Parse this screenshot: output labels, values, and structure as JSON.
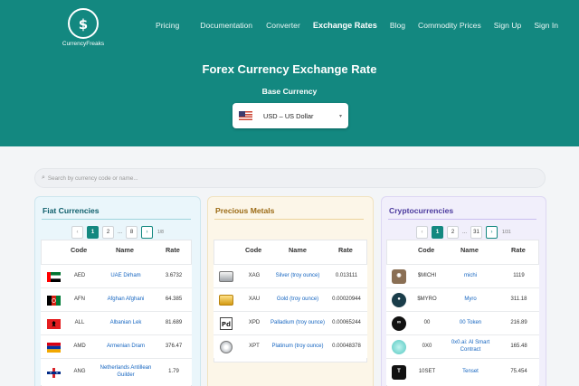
{
  "brand": {
    "name": "CurrencyFreaks",
    "logo_glyph": "$"
  },
  "nav": [
    {
      "label": "Pricing",
      "active": false
    },
    {
      "label": "Documentation",
      "active": false
    },
    {
      "label": "Converter",
      "active": false
    },
    {
      "label": "Exchange Rates",
      "active": true
    },
    {
      "label": "Blog",
      "active": false
    },
    {
      "label": "Commodity Prices",
      "active": false
    },
    {
      "label": "Sign Up",
      "active": false
    },
    {
      "label": "Sign In",
      "active": false
    }
  ],
  "hero": {
    "title": "Forex Currency Exchange Rate",
    "base_label": "Base Currency",
    "base_value": "USD – US Dollar",
    "base_flag_icon": "us-flag-icon"
  },
  "search": {
    "placeholder": "Search by currency code or name..."
  },
  "columns": {
    "code": "Code",
    "name": "Name",
    "rate": "Rate"
  },
  "fiat": {
    "title": "Fiat Currencies",
    "pager": {
      "prev": "‹",
      "p1": "1",
      "p2": "2",
      "dots": "...",
      "last": "8",
      "next": "›",
      "count": "1/8"
    },
    "rows": [
      {
        "code": "AED",
        "name": "UAE Dirham",
        "rate": "3.6732",
        "icon": "uae-flag-icon"
      },
      {
        "code": "AFN",
        "name": "Afghan Afghani",
        "rate": "64.385",
        "icon": "afghanistan-flag-icon"
      },
      {
        "code": "ALL",
        "name": "Albanian Lek",
        "rate": "81.689",
        "icon": "albania-flag-icon"
      },
      {
        "code": "AMD",
        "name": "Armenian Dram",
        "rate": "376.47",
        "icon": "armenia-flag-icon"
      },
      {
        "code": "ANG",
        "name": "Netherlands Antillean Guilder",
        "rate": "1.79",
        "icon": "netherlands-antilles-flag-icon"
      }
    ]
  },
  "metals": {
    "title": "Precious Metals",
    "rows": [
      {
        "code": "XAG",
        "name": "Silver (troy ounce)",
        "rate": "0.013111",
        "icon": "silver-bar-icon"
      },
      {
        "code": "XAU",
        "name": "Gold (troy ounce)",
        "rate": "0.00020944",
        "icon": "gold-bars-icon"
      },
      {
        "code": "XPD",
        "name": "Palladium (troy ounce)",
        "rate": "0.00065244",
        "icon": "palladium-element-icon"
      },
      {
        "code": "XPT",
        "name": "Platinum (troy ounce)",
        "rate": "0.00048378",
        "icon": "platinum-bar-icon"
      }
    ]
  },
  "crypto": {
    "title": "Cryptocurrencies",
    "pager": {
      "prev": "‹",
      "p1": "1",
      "p2": "2",
      "dots": "...",
      "last": "31",
      "next": "›",
      "count": "1/31"
    },
    "rows": [
      {
        "code": "$MICHI",
        "name": "michi",
        "rate": "1119",
        "icon": "michi-token-icon"
      },
      {
        "code": "$MYRO",
        "name": "Myro",
        "rate": "311.18",
        "icon": "myro-token-icon"
      },
      {
        "code": "00",
        "name": "00 Token",
        "rate": "216.89",
        "icon": "00-token-icon"
      },
      {
        "code": "0X0",
        "name": "0x0.ai: AI Smart Contract",
        "rate": "165.48",
        "icon": "0x0-token-icon"
      },
      {
        "code": "10SET",
        "name": "Tenset",
        "rate": "75.454",
        "icon": "tenset-token-icon"
      }
    ]
  },
  "colors": {
    "brand_teal": "#138880",
    "fiat_bg": "#eaf6fb",
    "metals_bg": "#fcf6e8",
    "crypto_bg": "#f1effb",
    "link_blue": "#1565c0"
  }
}
